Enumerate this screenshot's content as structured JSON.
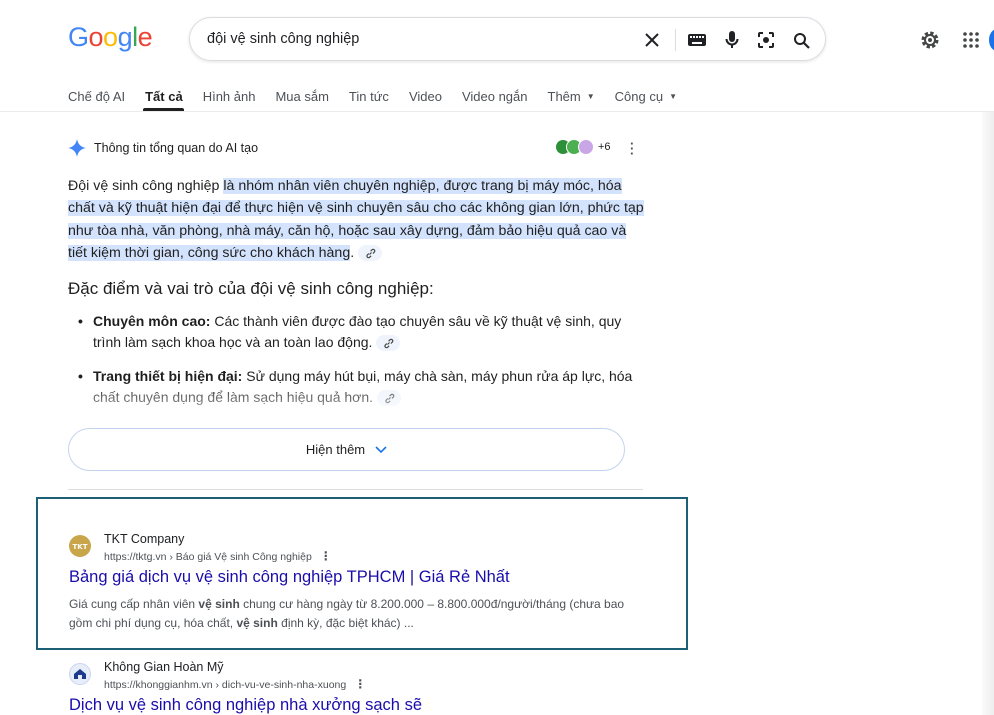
{
  "search": {
    "query": "đội vệ sinh công nghiệp"
  },
  "logo": {
    "letters": [
      "G",
      "o",
      "o",
      "g",
      "l",
      "e"
    ],
    "colors": [
      "#4285F4",
      "#EA4335",
      "#FBBC05",
      "#4285F4",
      "#34A853",
      "#EA4335"
    ]
  },
  "tabs": [
    {
      "label": "Chế độ AI"
    },
    {
      "label": "Tất cả"
    },
    {
      "label": "Hình ảnh"
    },
    {
      "label": "Mua sắm"
    },
    {
      "label": "Tin tức"
    },
    {
      "label": "Video"
    },
    {
      "label": "Video ngắn"
    },
    {
      "label": "Thêm"
    },
    {
      "label": "Công cụ"
    }
  ],
  "ai_overview": {
    "heading": "Thông tin tổng quan do AI tạo",
    "sources_count": "+6",
    "intro_plain": "Đội vệ sinh công nghiệp ",
    "intro_highlight": "là nhóm nhân viên chuyên nghiệp, được trang bị máy móc, hóa chất và kỹ thuật hiện đại để thực hiện vệ sinh chuyên sâu cho các không gian lớn, phức tạp như tòa nhà, văn phòng, nhà máy, căn hộ, hoặc sau xây dựng, đảm bảo hiệu quả cao và tiết kiệm thời gian, công sức cho khách hàng",
    "intro_end": ".",
    "subheading": "Đặc điểm và vai trò của đội vệ sinh công nghiệp:",
    "bullets": [
      {
        "bold": "Chuyên môn cao:",
        "text": " Các thành viên được đào tạo chuyên sâu về kỹ thuật vệ sinh, quy trình làm sạch khoa học và an toàn lao động."
      },
      {
        "bold": "Trang thiết bị hiện đại:",
        "text": " Sử dụng máy hút bụi, máy chà sàn, máy phun rửa áp lực, hóa chất chuyên dụng để làm sạch hiệu quả hơn."
      }
    ],
    "show_more": "Hiện thêm"
  },
  "results": [
    {
      "site": "TKT Company",
      "url": "https://tktg.vn › Báo giá Vệ sinh Công nghiệp",
      "title": "Bảng giá dịch vụ vệ sinh công nghiệp TPHCM | Giá Rẻ Nhất",
      "snippet_parts": [
        {
          "t": "Giá cung cấp nhân viên ",
          "b": false
        },
        {
          "t": "vệ sinh",
          "b": true
        },
        {
          "t": " chung cư hàng ngày từ 8.200.000 – 8.800.000đ/người/tháng (chưa bao gồm chi phí dụng cụ, hóa chất, ",
          "b": false
        },
        {
          "t": "vệ sinh",
          "b": true
        },
        {
          "t": " định kỳ, đặc biệt khác) ...",
          "b": false
        }
      ]
    },
    {
      "site": "Không Gian Hoàn Mỹ",
      "url": "https://khonggianhm.vn › dich-vu-ve-sinh-nha-xuong",
      "title": "Dịch vụ vệ sinh công nghiệp nhà xưởng sạch sẽ"
    }
  ],
  "colors": {
    "link": "#1a0dab",
    "highlight": "#d3e3fd",
    "result_border": "#1d5f75"
  }
}
